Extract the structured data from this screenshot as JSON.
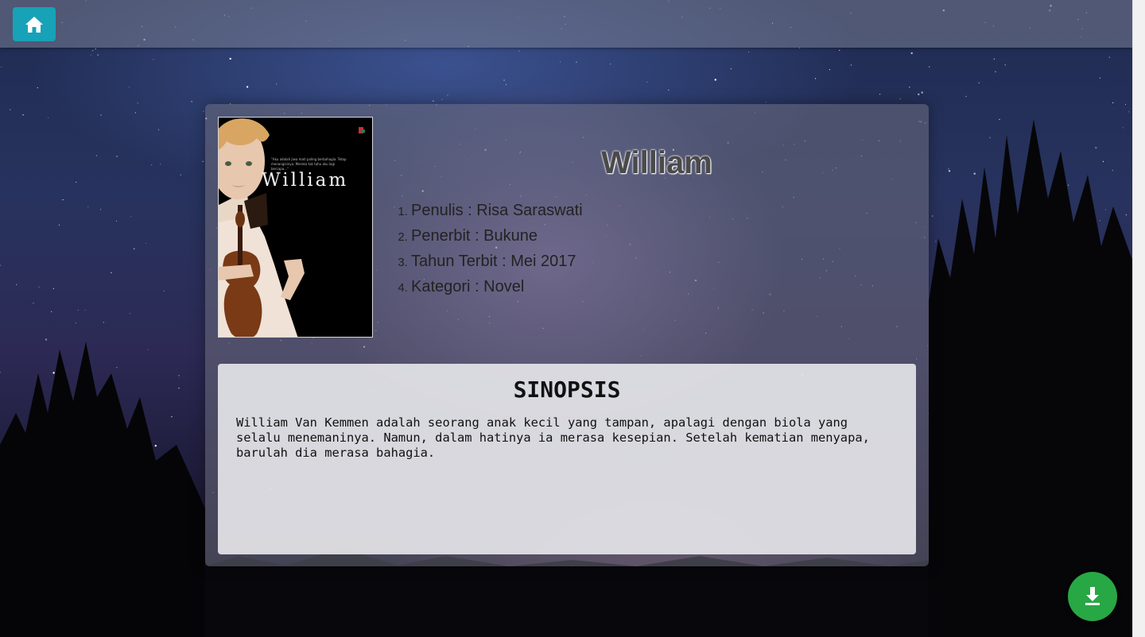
{
  "nav": {
    "home_icon": "home-icon"
  },
  "book": {
    "cover": {
      "title": "William",
      "quote": "\"Aku adalah jiwa mati paling berbahagia. Tetap menangisinya. Mereka tak tahu aku lagi bercapa...\""
    },
    "title": "William",
    "details": [
      "Penulis : Risa Saraswati",
      "Penerbit : Bukune",
      "Tahun Terbit : Mei 2017",
      "Kategori : Novel"
    ]
  },
  "synopsis": {
    "heading": "SINOPSIS",
    "text": "William Van Kemmen adalah seorang anak kecil yang tampan, apalagi dengan biola yang selalu menemaninya. Namun, dalam hatinya ia merasa kesepian. Setelah kematian menyapa, barulah dia merasa bahagia."
  },
  "actions": {
    "download_icon": "download-icon"
  },
  "colors": {
    "home_button": "#17a2b8",
    "download_button": "#28a745"
  }
}
